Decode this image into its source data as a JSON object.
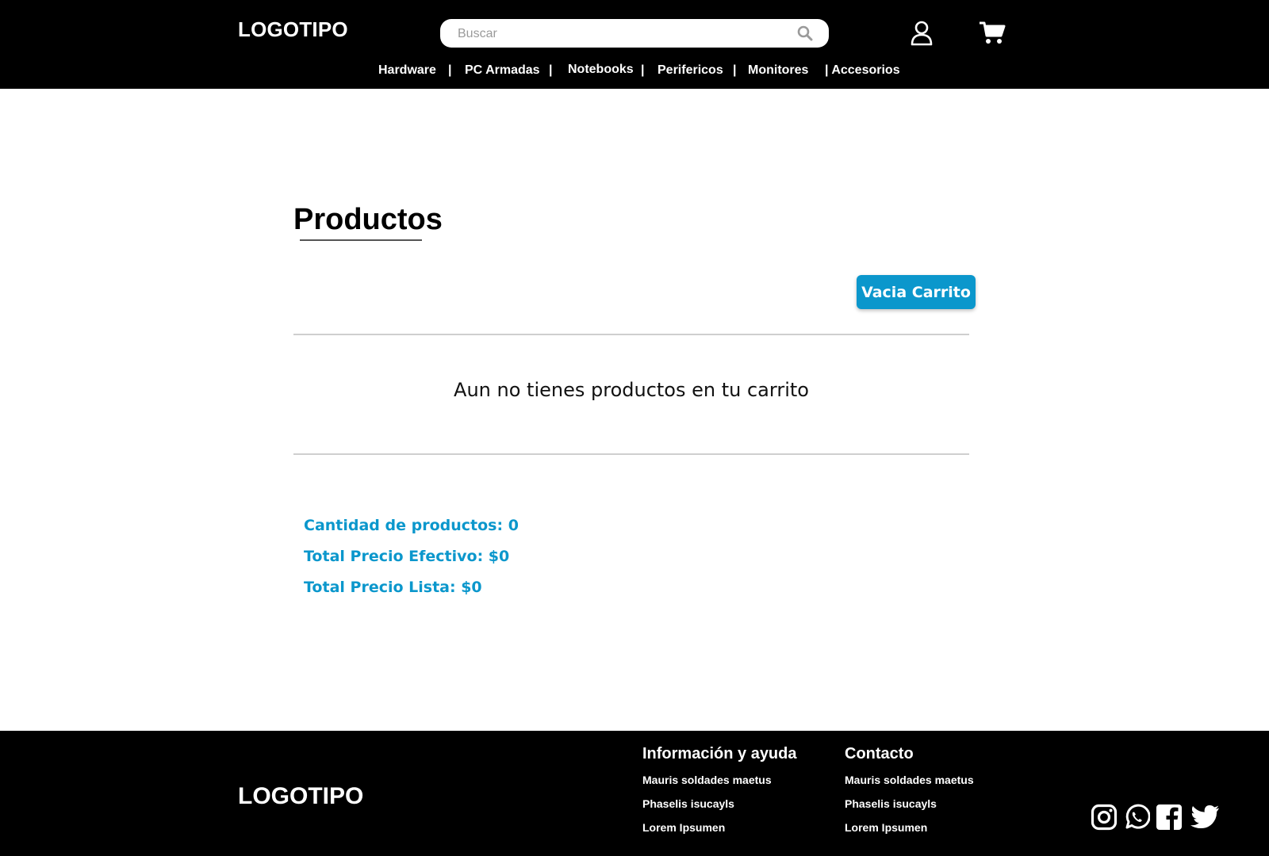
{
  "header": {
    "logo": "LOGOTIPO",
    "search": {
      "placeholder": "Buscar",
      "value": ""
    },
    "nav": [
      "Hardware",
      "|",
      "PC Armadas",
      "|",
      "Notebooks",
      "|",
      "Perifericos",
      "|",
      "Monitores",
      "| Accesorios"
    ]
  },
  "main": {
    "title": "Productos",
    "empty_cart_button": "Vacia Carrito",
    "empty_message": "Aun no tienes productos en tu carrito",
    "summary": {
      "quantity": "Cantidad de productos: 0",
      "total_cash": "Total Precio Efectivo: $0",
      "total_list": "Total Precio Lista: $0"
    }
  },
  "footer": {
    "logo": "LOGOTIPO",
    "info": {
      "title": "Información y ayuda",
      "links": [
        "Mauris soldades maetus",
        "Phaselis isucayls",
        "Lorem Ipsumen"
      ]
    },
    "contact": {
      "title": "Contacto",
      "links": [
        "Mauris soldades maetus",
        "Phaselis isucayls",
        "Lorem Ipsumen"
      ]
    },
    "social": [
      "instagram-icon",
      "whatsapp-icon",
      "facebook-icon",
      "twitter-icon"
    ]
  },
  "colors": {
    "accent": "#0b97cc",
    "header_bg": "#000000",
    "text": "#000000"
  }
}
